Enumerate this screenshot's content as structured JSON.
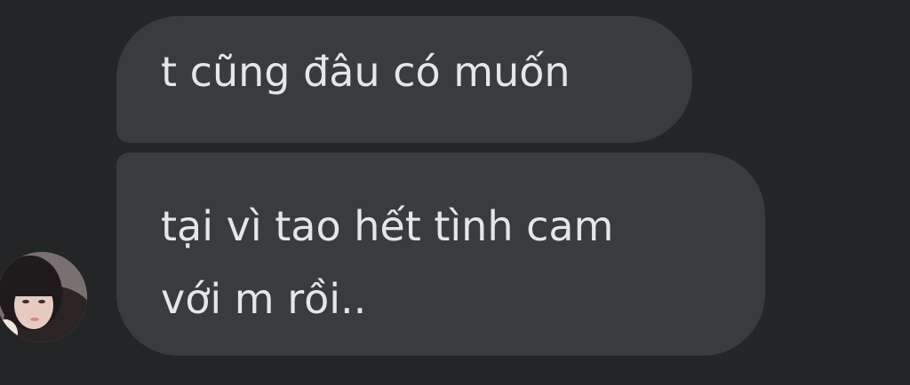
{
  "messages": [
    {
      "text": "t cũng đâu có muốn"
    },
    {
      "lines": [
        "tại vì tao hết tình cam",
        "với m rồi.."
      ]
    }
  ],
  "colors": {
    "background": "#242526",
    "bubble": "#3a3b3c",
    "text": "#e4e6eb"
  },
  "avatar": {
    "icon": "user-avatar-photo"
  }
}
